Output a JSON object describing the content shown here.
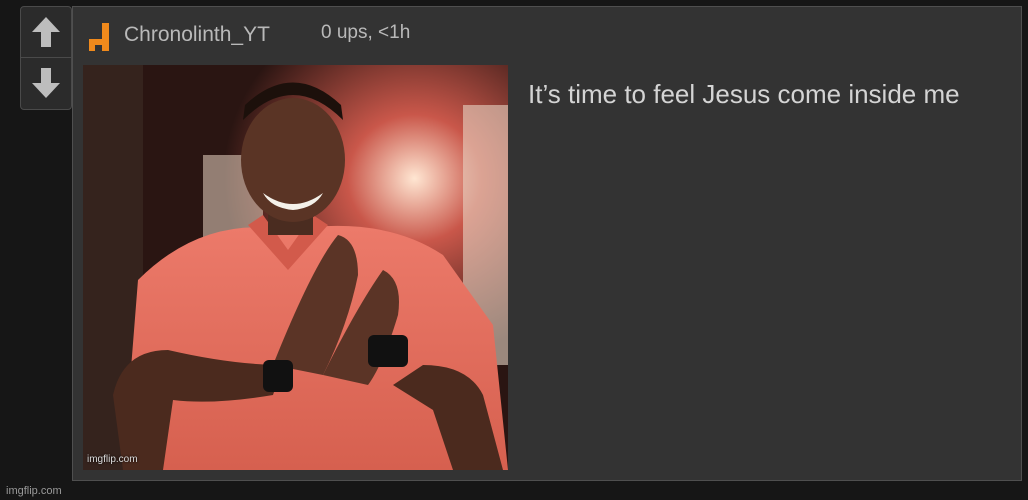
{
  "vote": {
    "up_icon": "arrow-up-icon",
    "down_icon": "arrow-down-icon"
  },
  "comment": {
    "username": "Chronolinth_YT",
    "meta": "0 ups, <1h",
    "text": "It’s time to feel Jesus come inside me"
  },
  "image": {
    "watermark": "imgflip.com"
  },
  "footer": {
    "watermark": "imgflip.com"
  },
  "colors": {
    "background": "#161616",
    "card": "#333333",
    "avatar_accent": "#f08a1c",
    "text": "#d4d4d4"
  }
}
